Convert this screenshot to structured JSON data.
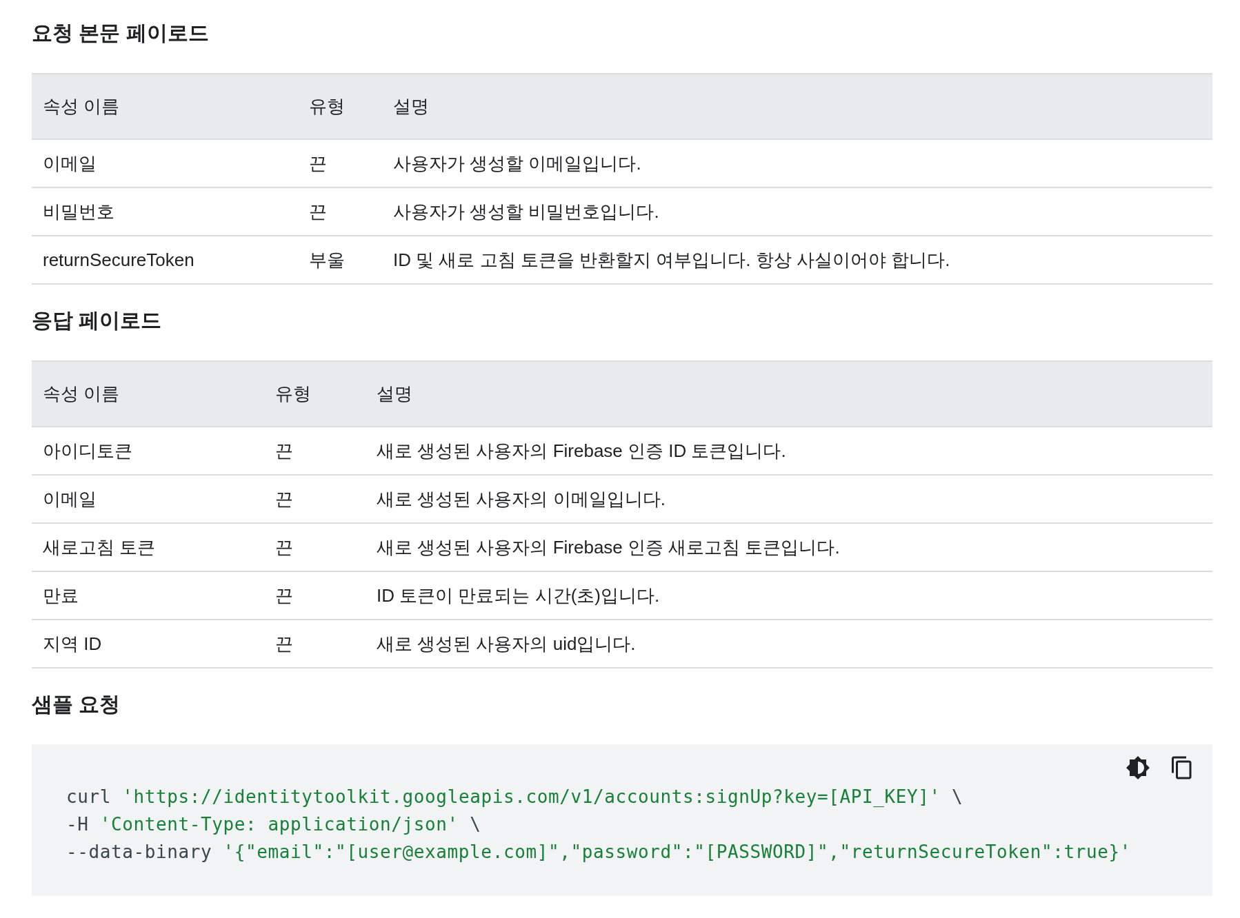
{
  "sections": [
    {
      "heading": "요청 본문 페이로드",
      "table": {
        "columns": [
          "속성 이름",
          "유형",
          "설명"
        ],
        "rows": [
          [
            "이메일",
            "끈",
            "사용자가 생성할 이메일입니다."
          ],
          [
            "비밀번호",
            "끈",
            "사용자가 생성할 비밀번호입니다."
          ],
          [
            "returnSecureToken",
            "부울",
            "ID 및 새로 고침 토큰을 반환할지 여부입니다. 항상 사실이어야 합니다."
          ]
        ]
      }
    },
    {
      "heading": "응답 페이로드",
      "table": {
        "columns": [
          "속성 이름",
          "유형",
          "설명"
        ],
        "rows": [
          [
            "아이디토큰",
            "끈",
            "새로 생성된 사용자의 Firebase 인증 ID 토큰입니다."
          ],
          [
            "이메일",
            "끈",
            "새로 생성된 사용자의 이메일입니다."
          ],
          [
            "새로고침 토큰",
            "끈",
            "새로 생성된 사용자의 Firebase 인증 새로고침 토큰입니다."
          ],
          [
            "만료",
            "끈",
            "ID 토큰이 만료되는 시간(초)입니다."
          ],
          [
            "지역 ID",
            "끈",
            "새로 생성된 사용자의 uid입니다."
          ]
        ]
      }
    },
    {
      "heading": "샘플 요청",
      "code": {
        "lines": [
          [
            {
              "kind": "plain",
              "text": "curl "
            },
            {
              "kind": "string",
              "text": "'https://identitytoolkit.googleapis.com/v1/accounts:signUp?key=[API_KEY]'"
            },
            {
              "kind": "plain",
              "text": " \\"
            }
          ],
          [
            {
              "kind": "plain",
              "text": "-H "
            },
            {
              "kind": "string",
              "text": "'Content-Type: application/json'"
            },
            {
              "kind": "plain",
              "text": " \\"
            }
          ],
          [
            {
              "kind": "plain",
              "text": "--data-binary "
            },
            {
              "kind": "string",
              "text": "'{\"email\":\"[user@example.com]\",\"password\":\"[PASSWORD]\",\"returnSecureToken\":true}'"
            }
          ]
        ]
      }
    }
  ]
}
